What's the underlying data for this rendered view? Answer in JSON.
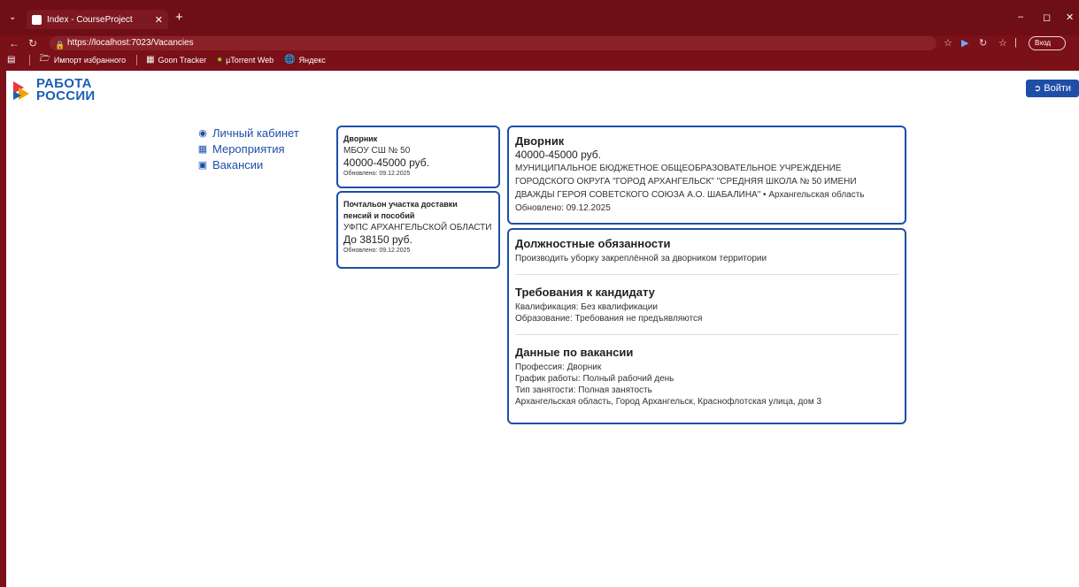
{
  "browser": {
    "tab_title": "Index - CourseProject",
    "url": "https://localhost:7023/Vacancies",
    "profile_button": "Вход",
    "bookmarks": [
      "Импорт избранного",
      "Goon Tracker",
      "µTorrent Web",
      "Яндекс"
    ]
  },
  "header": {
    "logo_line1": "РАБОТА",
    "logo_line2": "РОССИИ",
    "login_label": "Войти"
  },
  "sidebar": {
    "items": [
      {
        "label": "Личный кабинет",
        "icon": "user-circle-icon"
      },
      {
        "label": "Мероприятия",
        "icon": "calendar-icon"
      },
      {
        "label": "Вакансии",
        "icon": "id-card-icon"
      }
    ]
  },
  "vacancies": [
    {
      "title": "Дворник",
      "org": "МБОУ СШ № 50",
      "salary": "40000-45000 руб.",
      "updated": "Обновлено: 09.12.2025"
    },
    {
      "title_line1": "Почтальон участка доставки",
      "title_line2": "пенсий и пособий",
      "org": "УФПС АРХАНГЕЛЬСКОЙ ОБЛАСТИ",
      "salary": "До 38150 руб.",
      "updated": "Обновлено: 09.12.2025"
    }
  ],
  "detail": {
    "title": "Дворник",
    "salary": "40000-45000 руб.",
    "org_line1": "МУНИЦИПАЛЬНОЕ БЮДЖЕТНОЕ ОБЩЕОБРАЗОВАТЕЛЬНОЕ УЧРЕЖДЕНИЕ",
    "org_line2": "ГОРОДСКОГО ОКРУГА \"ГОРОД АРХАНГЕЛЬСК\" \"СРЕДНЯЯ ШКОЛА № 50 ИМЕНИ",
    "org_line3": "ДВАЖДЫ ГЕРОЯ СОВЕТСКОГО СОЮЗА А.О. ШАБАЛИНА\" • Архангельская область",
    "updated": "Обновлено: 09.12.2025",
    "duties_title": "Должностные обязанности",
    "duties_text": "Производить уборку закреплённой за дворником территории",
    "requirements_title": "Требования к кандидату",
    "qualification": "Квалификация: Без квалификации",
    "education": "Образование: Требования не предъявляются",
    "data_title": "Данные по вакансии",
    "profession": "Профессия: Дворник",
    "schedule": "График работы: Полный рабочий день",
    "employment": "Тип занятости: Полная занятость",
    "address": "Архангельская область, Город Архангельск, Краснофлотская улица, дом 3"
  },
  "colors": {
    "browser_frame": "#7a1018",
    "accent_blue": "#1f4ea8",
    "logo_red": "#e63946",
    "logo_yellow": "#f4a300"
  }
}
